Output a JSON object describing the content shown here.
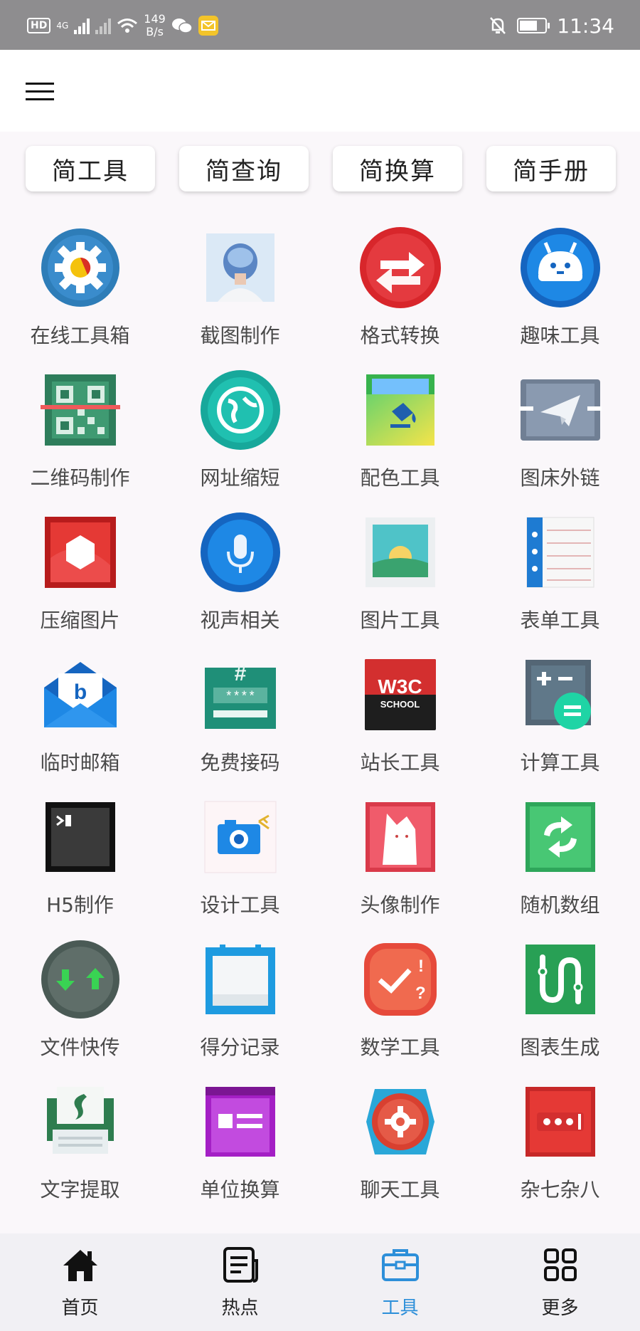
{
  "status_bar": {
    "hd_badge": "HD",
    "net_type": "4G",
    "speed_value": "149",
    "speed_unit": "B/s",
    "time": "11:34"
  },
  "categories": [
    {
      "label": "简工具"
    },
    {
      "label": "简查询"
    },
    {
      "label": "简换算"
    },
    {
      "label": "简手册"
    }
  ],
  "tools": [
    {
      "label": "在线工具箱",
      "icon": "gear-icon"
    },
    {
      "label": "截图制作",
      "icon": "portrait-icon"
    },
    {
      "label": "格式转换",
      "icon": "swap-arrows-icon"
    },
    {
      "label": "趣味工具",
      "icon": "android-face-icon"
    },
    {
      "label": "二维码制作",
      "icon": "qr-code-icon"
    },
    {
      "label": "网址缩短",
      "icon": "globe-icon"
    },
    {
      "label": "配色工具",
      "icon": "paint-bucket-icon"
    },
    {
      "label": "图床外链",
      "icon": "paper-plane-icon"
    },
    {
      "label": "压缩图片",
      "icon": "hexagon-icon"
    },
    {
      "label": "视声相关",
      "icon": "microphone-icon"
    },
    {
      "label": "图片工具",
      "icon": "landscape-image-icon"
    },
    {
      "label": "表单工具",
      "icon": "form-list-icon"
    },
    {
      "label": "临时邮箱",
      "icon": "mail-envelope-icon"
    },
    {
      "label": "免费接码",
      "icon": "password-keypad-icon"
    },
    {
      "label": "站长工具",
      "icon": "w3c-school-icon",
      "icon_text_1": "W3C",
      "icon_text_2": "SCHOOL"
    },
    {
      "label": "计算工具",
      "icon": "calculator-icon"
    },
    {
      "label": "H5制作",
      "icon": "terminal-icon"
    },
    {
      "label": "设计工具",
      "icon": "camera-icon"
    },
    {
      "label": "头像制作",
      "icon": "cat-avatar-icon"
    },
    {
      "label": "随机数组",
      "icon": "refresh-icon"
    },
    {
      "label": "文件快传",
      "icon": "transfer-arrows-icon"
    },
    {
      "label": "得分记录",
      "icon": "calendar-icon"
    },
    {
      "label": "数学工具",
      "icon": "check-question-icon"
    },
    {
      "label": "图表生成",
      "icon": "chart-path-icon"
    },
    {
      "label": "文字提取",
      "icon": "scanner-icon"
    },
    {
      "label": "单位换算",
      "icon": "card-icon"
    },
    {
      "label": "聊天工具",
      "icon": "settings-badge-icon"
    },
    {
      "label": "杂七杂八",
      "icon": "more-dots-icon"
    }
  ],
  "bottom_nav": [
    {
      "label": "首页",
      "icon": "home-icon",
      "active": false
    },
    {
      "label": "热点",
      "icon": "news-icon",
      "active": false
    },
    {
      "label": "工具",
      "icon": "toolbox-icon",
      "active": true
    },
    {
      "label": "更多",
      "icon": "grid-icon",
      "active": false
    }
  ],
  "colors": {
    "accent": "#2d8fd9",
    "status_bar": "#8e8d8f",
    "background": "#faf7fa"
  }
}
